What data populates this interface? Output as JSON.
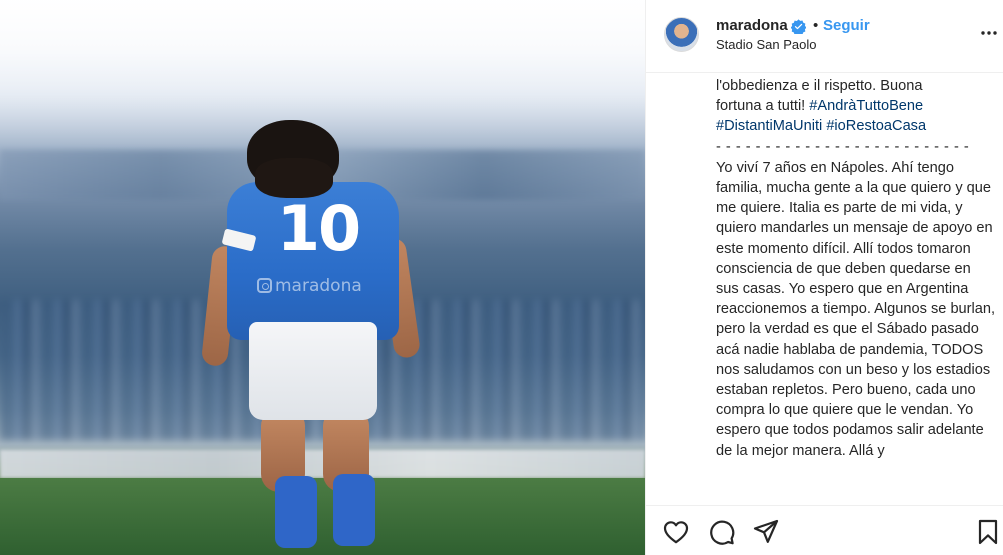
{
  "photo": {
    "jersey_number": "10",
    "watermark": "maradona"
  },
  "header": {
    "username": "maradona",
    "separator": "•",
    "follow_label": "Seguir",
    "location": "Stadio San Paolo"
  },
  "caption": {
    "line_it_1": "l'obbedienza e il rispetto. Buona",
    "line_it_2": "fortuna a tutti! ",
    "tag_1": "#AndràTuttoBene",
    "tag_2": "#DistantiMaUniti",
    "tag_3": "#ioRestoaCasa",
    "separator": "- - - - - - - - - - - - - - - - - - - - - - - - - -",
    "spanish": "Yo viví 7 años en Nápoles. Ahí tengo familia, mucha gente a la que quiero y que me quiere. Italia es parte de mi vida, y quiero mandarles un mensaje de apoyo en este momento difícil. Allí todos tomaron consciencia de que deben quedarse en sus casas. Yo espero que en Argentina reaccionemos a tiempo. Algunos se burlan, pero la verdad es que el Sábado pasado acá nadie hablaba de pandemia, TODOS nos saludamos con un beso y los estadios estaban repletos. Pero bueno, cada uno compra lo que quiere que le vendan. Yo espero que todos podamos salir adelante de la mejor manera. Allá y"
  },
  "colors": {
    "link": "#3897f0",
    "hashtag": "#00376b",
    "text": "#262626",
    "verified": "#3897f0"
  },
  "icons": {
    "like": "heart-icon",
    "comment": "comment-icon",
    "share": "share-icon",
    "save": "bookmark-icon",
    "more": "more-options-icon",
    "verified": "verified-badge-icon"
  }
}
